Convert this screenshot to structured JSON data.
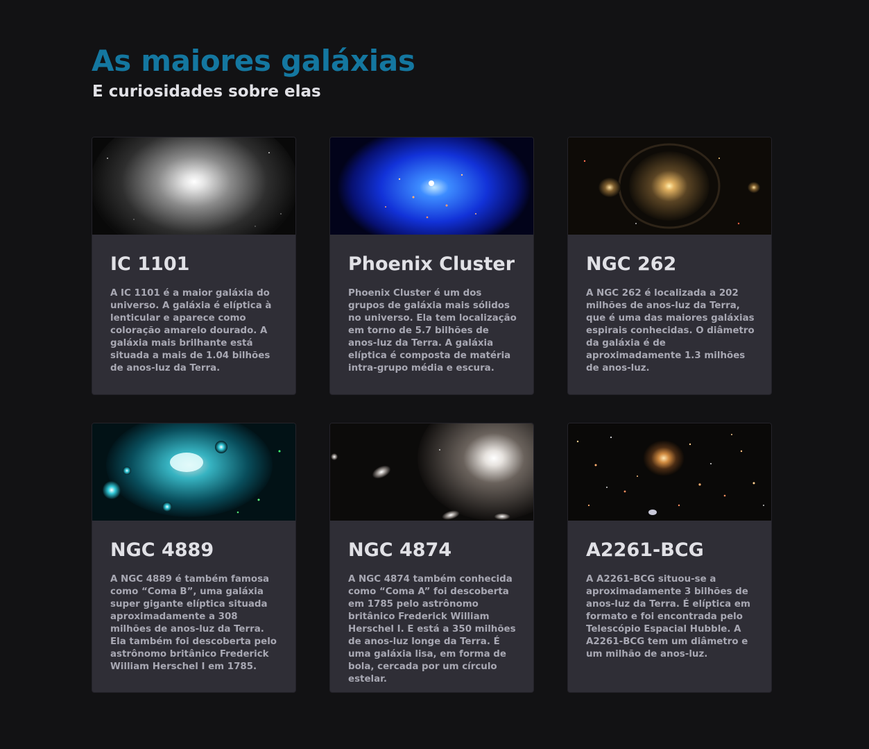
{
  "header": {
    "title": "As maiores galáxias",
    "subtitle": "E curiosidades sobre elas"
  },
  "cards": [
    {
      "title": "IC 1101",
      "text": "A IC 1101 é a maior galáxia do universo. A galáxia é elíptica à lenticular e aparece como coloração amarelo dourado. A galáxia mais brilhante está situada a mais de 1.04 bilhões de anos-luz da Terra.",
      "image": "bright-white-elliptical-galaxy-image"
    },
    {
      "title": "Phoenix Cluster",
      "text": "Phoenix Cluster é um dos grupos de galáxia mais sólidos no universo. Ela tem localização em torno de 5.7 bilhões de anos-luz da Terra. A galáxia elíptica é composta de matéria intra-grupo média e escura.",
      "image": "blue-galaxy-cluster-image"
    },
    {
      "title": "NGC 262",
      "text": "A NGC 262 é localizada a 202 milhões de anos-luz da Terra, que é uma das maiores galáxias espirais conhecidas. O diâmetro da galáxia é de aproximadamente 1.3 milhões de anos-luz.",
      "image": "golden-spiral-galaxy-image"
    },
    {
      "title": "NGC 4889",
      "text": "A NGC 4889 é também famosa como “Coma B”, uma galáxia super gigante elíptica situada aproximadamente a 308 milhões de anos-luz da Terra. Ela também foi descoberta pelo astrônomo britânico Frederick William Herschel I em 1785.",
      "image": "cyan-galaxy-field-image"
    },
    {
      "title": "NGC 4874",
      "text": "A NGC 4874 também conhecida como “Coma A” foi descoberta em 1785 pelo astrônomo britânico Frederick William Herschel I. E está a 350 milhões de anos-luz longe da Terra. É uma galáxia lisa, em forma de bola, cercada por um círculo estelar.",
      "image": "smooth-elliptical-galaxy-image"
    },
    {
      "title": "A2261-BCG",
      "text": "A A2261-BCG situou-se a aproximadamente 3 bilhões de anos-luz da Terra. É elíptica em formato e foi encontrada pelo Telescópio Espacial Hubble. A A2261-BCG tem um diâmetro e um milhão de anos-luz.",
      "image": "galaxy-cluster-field-image"
    }
  ],
  "colors": {
    "background": "#121214",
    "card": "#2f2e36",
    "accent": "#1477a0",
    "heading": "#e1e1e6",
    "body_text": "#a8a8b3"
  }
}
